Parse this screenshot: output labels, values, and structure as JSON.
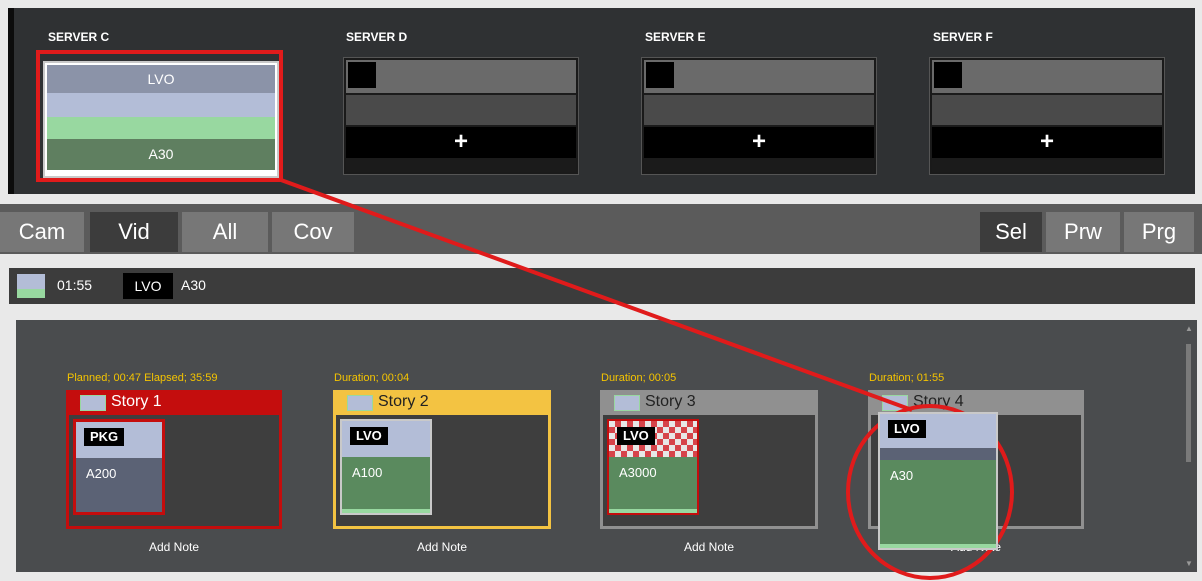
{
  "servers": [
    {
      "label": "SERVER C",
      "active": true,
      "top_label": "LVO",
      "bottom_label": "A30"
    },
    {
      "label": "SERVER D",
      "active": false,
      "add": "+"
    },
    {
      "label": "SERVER E",
      "active": false,
      "add": "+"
    },
    {
      "label": "SERVER F",
      "active": false,
      "add": "+"
    }
  ],
  "tabs_left": [
    {
      "label": "Cam",
      "active": false
    },
    {
      "label": "Vid",
      "active": true
    },
    {
      "label": "All",
      "active": false
    },
    {
      "label": "Cov",
      "active": false
    }
  ],
  "tabs_right": [
    {
      "label": "Sel",
      "active": true
    },
    {
      "label": "Prw",
      "active": false
    },
    {
      "label": "Prg",
      "active": false
    }
  ],
  "info": {
    "time": "01:55",
    "badge": "LVO",
    "code": "A30"
  },
  "stories": [
    {
      "status": "Planned; 00:47 Elapsed; 35:59",
      "title": "Story 1",
      "clip_badge": "PKG",
      "clip_code": "A200",
      "note": "Add Note",
      "state": "red"
    },
    {
      "status": "Duration; 00:04",
      "title": "Story 2",
      "clip_badge": "LVO",
      "clip_code": "A100",
      "note": "Add Note",
      "state": "yellow"
    },
    {
      "status": "Duration; 00:05",
      "title": "Story 3",
      "clip_badge": "LVO",
      "clip_code": "A3000",
      "note": "Add Note",
      "state": "gray"
    },
    {
      "status": "Duration; 01:55",
      "title": "Story 4",
      "clip_badge": "LVO",
      "clip_code": "A30",
      "note": "Add Note",
      "state": "gray-highlight"
    }
  ],
  "colors": {
    "red": "#c40d0d",
    "yellow": "#f3c342",
    "annotation_red": "#e01b1b",
    "status_text": "#f5c400"
  }
}
